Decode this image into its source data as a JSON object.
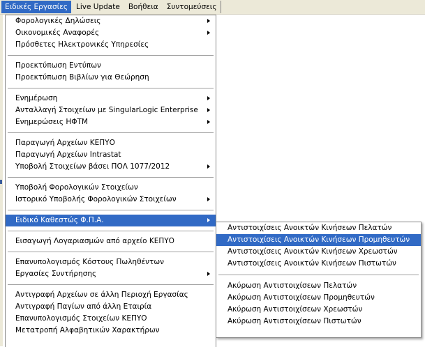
{
  "menubar": {
    "items": [
      {
        "label": "Ειδικές Εργασίες"
      },
      {
        "label": "Live Update"
      },
      {
        "label": "Βοήθεια"
      },
      {
        "label": "Συντομεύσεις"
      }
    ]
  },
  "main_menu": {
    "groups": [
      [
        {
          "label": "Φορολογικές Δηλώσεις",
          "submenu": true
        },
        {
          "label": "Οικονομικές Αναφορές",
          "submenu": true
        },
        {
          "label": "Πρόσθετες Ηλεκτρονικές Υπηρεσίες",
          "submenu": false
        }
      ],
      [
        {
          "label": "Προεκτύπωση Εντύπων",
          "submenu": false
        },
        {
          "label": "Προεκτύπωση Βιβλίων για Θεώρηση",
          "submenu": false
        }
      ],
      [
        {
          "label": "Ενημέρωση",
          "submenu": true
        },
        {
          "label": "Ανταλλαγή Στοιχείων με SingularLogic Enterprise",
          "submenu": true
        },
        {
          "label": "Ενημερώσεις ΗΦΤΜ",
          "submenu": true
        }
      ],
      [
        {
          "label": "Παραγωγή Αρχείων ΚΕΠΥΟ",
          "submenu": false
        },
        {
          "label": "Παραγωγή Αρχείων Intrastat",
          "submenu": false
        },
        {
          "label": "Υποβολή Στοιχείων βάσει ΠΟΛ 1077/2012",
          "submenu": true
        }
      ],
      [
        {
          "label": "Υποβολή Φορολογικών Στοιχείων",
          "submenu": false
        },
        {
          "label": "Ιστορικό Υποβολής Φορολογικών Στοιχείων",
          "submenu": true
        }
      ],
      [
        {
          "label": "Ειδικό Καθεστώς Φ.Π.Α.",
          "submenu": true,
          "highlighted": true
        }
      ],
      [
        {
          "label": "Εισαγωγή Λογαριασμών από αρχείο ΚΕΠΥΟ",
          "submenu": false
        }
      ],
      [
        {
          "label": "Επανυπολογισμός Κόστους Πωληθέντων",
          "submenu": false
        },
        {
          "label": "Εργασίες Συντήρησης",
          "submenu": true
        }
      ],
      [
        {
          "label": "Αντιγραφή Αρχείων σε άλλη Περιοχή Εργασίας",
          "submenu": false
        },
        {
          "label": "Αντιγραφή Παγίων από άλλη Εταιρία",
          "submenu": false
        },
        {
          "label": "Επανυπολογισμός Στοιχείων ΚΕΠΥΟ",
          "submenu": false
        },
        {
          "label": "Μετατροπή Αλφαβητικών Χαρακτήρων",
          "submenu": false
        }
      ]
    ]
  },
  "sub_menu": {
    "groups": [
      [
        {
          "label": "Αντιστοιχίσεις Ανοικτών Κινήσεων Πελατών"
        },
        {
          "label": "Αντιστοιχίσεις Ανοικτών Κινήσεων Προμηθευτών",
          "highlighted": true
        },
        {
          "label": "Αντιστοιχίσεις Ανοικτών Κινήσεων Χρεωστών"
        },
        {
          "label": "Αντιστοιχίσεις Ανοικτών Κινήσεων Πιστωτών"
        }
      ],
      [
        {
          "label": "Ακύρωση Αντιστοιχίσεων Πελατών"
        },
        {
          "label": "Ακύρωση Αντιστοιχίσεων Προμηθευτών"
        },
        {
          "label": "Ακύρωση Αντιστοιχίσεων Χρεωστών"
        },
        {
          "label": "Ακύρωση Αντιστοιχίσεων Πιστωτών"
        }
      ]
    ]
  },
  "colors": {
    "highlight": "#316ac5",
    "menubar_bg": "#ece9d8"
  }
}
